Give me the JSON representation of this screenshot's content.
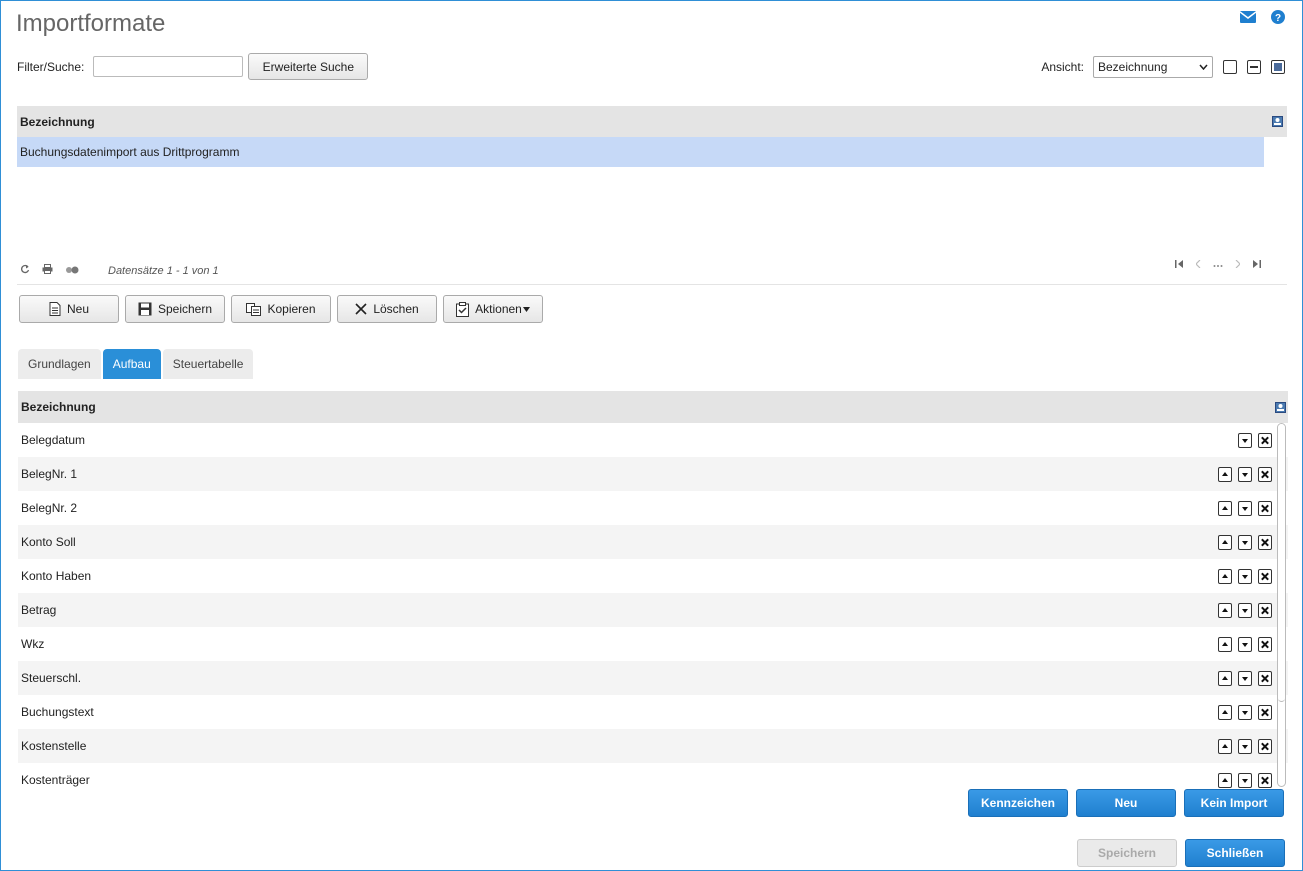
{
  "page": {
    "title": "Importformate"
  },
  "header": {
    "icons": [
      "mail-icon",
      "help-icon"
    ]
  },
  "filter": {
    "label": "Filter/Suche:",
    "value": "",
    "advanced_button": "Erweiterte Suche"
  },
  "view": {
    "label": "Ansicht:",
    "selected": "Bezeichnung"
  },
  "grid1": {
    "column": "Bezeichnung",
    "rows": [
      "Buchungsdatenimport aus Drittprogramm"
    ],
    "records": "Datensätze 1 - 1 von 1"
  },
  "toolbar": {
    "new": "Neu",
    "save": "Speichern",
    "copy": "Kopieren",
    "delete": "Löschen",
    "actions": "Aktionen"
  },
  "tabs": [
    "Grundlagen",
    "Aufbau",
    "Steuertabelle"
  ],
  "active_tab": "Aufbau",
  "grid2": {
    "column": "Bezeichnung",
    "rows": [
      "Belegdatum",
      "BelegNr. 1",
      "BelegNr. 2",
      "Konto Soll",
      "Konto Haben",
      "Betrag",
      "Wkz",
      "Steuerschl.",
      "Buchungstext",
      "Kostenstelle",
      "Kostenträger"
    ]
  },
  "grid_actions": {
    "flag": "Kennzeichen",
    "new": "Neu",
    "no_import": "Kein Import"
  },
  "footer": {
    "save": "Speichern",
    "close": "Schließen"
  },
  "colors": {
    "accent": "#2a8fd8",
    "selected_row": "#c6d9f7",
    "header_bg": "#e4e4e4"
  }
}
